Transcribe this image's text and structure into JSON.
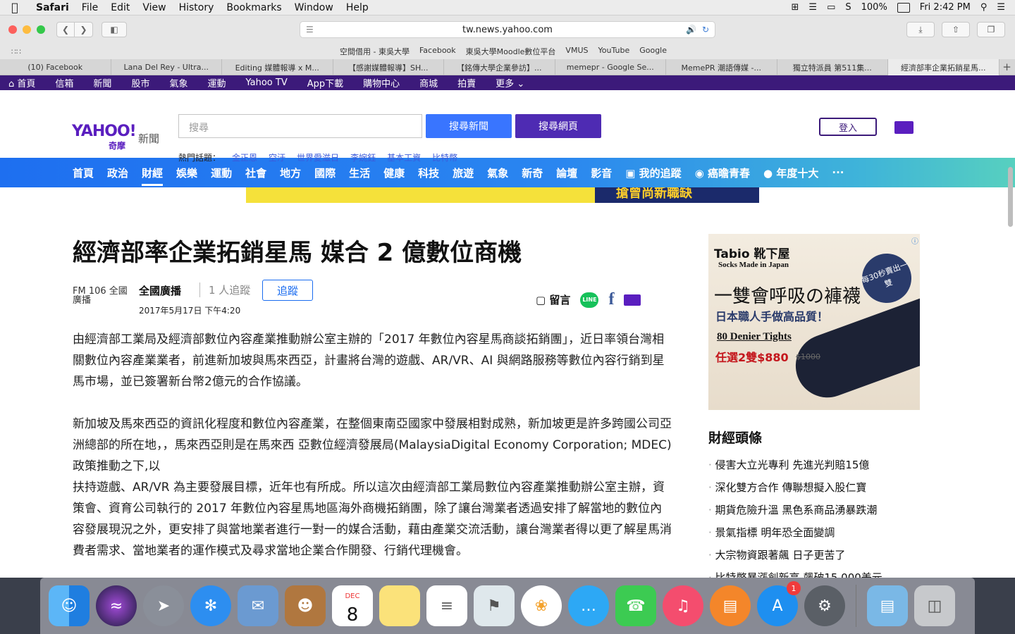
{
  "menubar": {
    "items": [
      "Safari",
      "File",
      "Edit",
      "View",
      "History",
      "Bookmarks",
      "Window",
      "Help"
    ],
    "battery": "100%",
    "clock": "Fri 2:42 PM"
  },
  "browser": {
    "url": "tw.news.yahoo.com",
    "favorites": [
      "空間借用 - 東吳大學",
      "Facebook",
      "東吳大學Moodle數位平台",
      "VMUS",
      "YouTube",
      "Google"
    ],
    "tabs": [
      "(10) Facebook",
      "Lana Del Rey - Ultra...",
      "Editing 媒體報導 x M...",
      "【感謝媒體報導】SH...",
      "【銘傳大學企業參訪】...",
      "memepr - Google Se...",
      "MemePR 潮語傳媒 -...",
      "獨立特派員 第511集...",
      "經濟部率企業拓銷星馬..."
    ]
  },
  "topnav": [
    "首頁",
    "信箱",
    "新聞",
    "股市",
    "氣象",
    "運動",
    "Yahoo TV",
    "App下載",
    "購物中心",
    "商城",
    "拍賣",
    "更多"
  ],
  "header": {
    "logo": "YAHOO!",
    "logo_sub": "奇摩",
    "logo_news": "新聞",
    "search_placeholder": "搜尋",
    "search_news": "搜尋新聞",
    "search_web": "搜尋網頁",
    "hot_label": "熱門話題：",
    "hot_topics": [
      "金正恩",
      "空汙",
      "世界愛滋日",
      "李婉鈺",
      "基本工資",
      "比特幣"
    ],
    "login": "登入"
  },
  "catnav": [
    "首頁",
    "政治",
    "財經",
    "娛樂",
    "運動",
    "社會",
    "地方",
    "國際",
    "生活",
    "健康",
    "科技",
    "旅遊",
    "氣象",
    "新奇",
    "論壇",
    "影音",
    "我的追蹤",
    "癌曕青春",
    "年度十大",
    "···"
  ],
  "catnav_active": "財經",
  "top_ad_text": "搶曾尚新職缺",
  "article": {
    "title": "經濟部率企業拓銷星馬 媒合 2 億數位商機",
    "source_logo": "FM 106 全國廣播",
    "source": "全國廣播",
    "followers": "1 人追蹤",
    "follow": "追蹤",
    "date": "2017年5月17日 下午4:20",
    "comment": "留言",
    "line": "LINE",
    "p1": "由經濟部工業局及經濟部數位內容產業推動辦公室主辦的「2017 年數位內容星馬商談拓銷團」，近日率領台灣相關數位內容產業業者，前進新加坡與馬來西亞，計畫將台灣的遊戲、AR/VR、AI 與網路服務等數位內容行銷到星馬市場，並已簽署新台幣2億元的合作協議。",
    "p2a": "新加坡及馬來西亞的資訊化程度和數位內容產業，在整個東南亞國家中發展相對成熟，新加坡更是許多跨國公司亞洲總部的所在地，，馬來西亞則是在馬來西 亞數位經濟發展局(MalaysiaDigital Economy Corporation; MDEC)政策推動之下,以",
    "p2b": "扶持遊戲、AR/VR 為主要發展目標，近年也有所成。所以這次由經濟部工業局數位內容產業推動辦公室主辦，資策會、資育公司執行的 2017 年數位內容星馬地區海外商機拓銷團，除了讓台灣業者透過安排了解當地的數位內容發展現況之外，更安排了與當地業者進行一對一的媒合活動，藉由產業交流活動，讓台灣業者得以更了解星馬消費者需求、當地業者的運作模式及尋求當地企業合作開發、行銷代理機會。"
  },
  "side_ad": {
    "brand": "Tabio 靴下屋",
    "tag": "Socks Made in Japan",
    "headline": "一雙會呼吸の褲襪",
    "sub": "日本職人手做高品質！",
    "product": "80 Denier Tights",
    "price": "任選2雙$880",
    "old_price": "$1000",
    "badge": "每30秒賣出一雙"
  },
  "finance": {
    "title": "財經頭條",
    "items": [
      "侵害大立光專利 先進光判賠15億",
      "深化雙方合作 傳聯想擬入股仁寶",
      "期貨危險升溫 黑色系商品湧暴跌潮",
      "景氣指標 明年恐全面變調",
      "大宗物資跟著飆 日子更苦了",
      "比特幣暴漲創新高 飆破15,000美元"
    ]
  },
  "dock": {
    "calendar_month": "DEC",
    "calendar_day": "8",
    "appstore_badge": "1"
  }
}
